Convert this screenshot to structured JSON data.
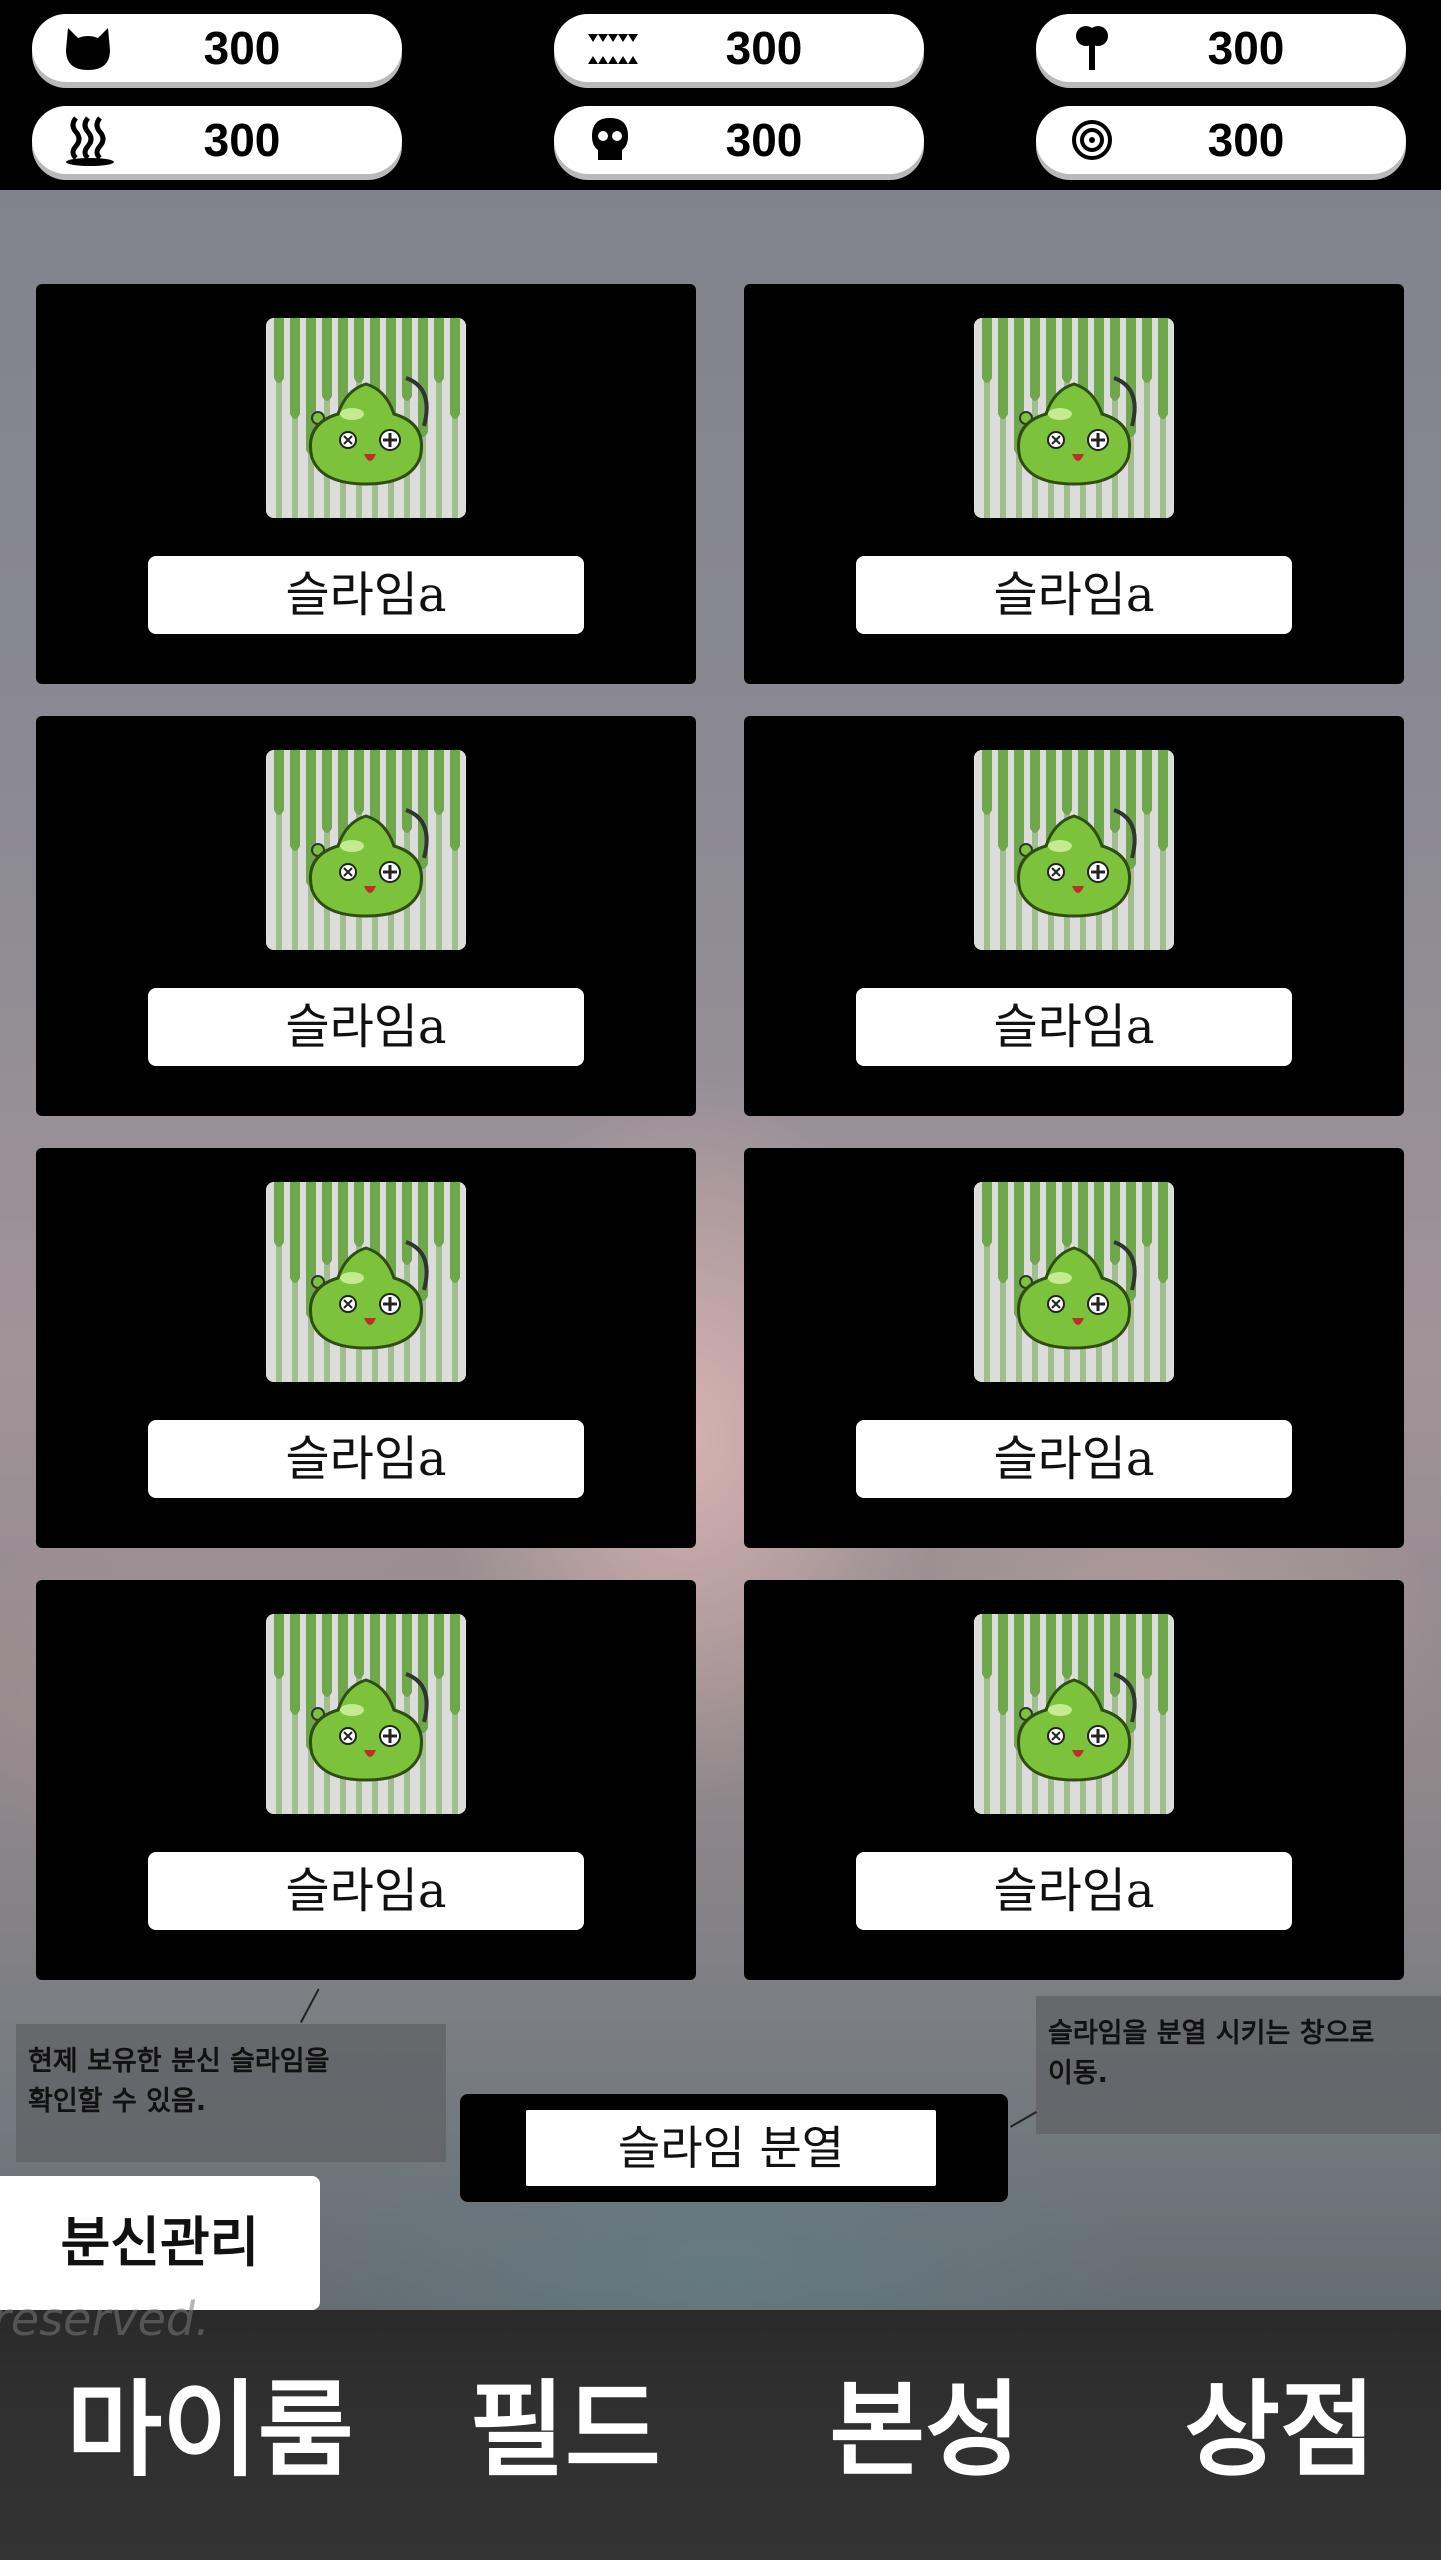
{
  "resources": [
    {
      "icon": "cat-face-icon",
      "value": "300"
    },
    {
      "icon": "spike-teeth-icon",
      "value": "300"
    },
    {
      "icon": "tree-icon",
      "value": "300"
    },
    {
      "icon": "steam-icon",
      "value": "300"
    },
    {
      "icon": "skull-icon",
      "value": "300"
    },
    {
      "icon": "target-icon",
      "value": "300"
    }
  ],
  "clones": [
    {
      "name": "슬라임a"
    },
    {
      "name": "슬라임a"
    },
    {
      "name": "슬라임a"
    },
    {
      "name": "슬라임a"
    },
    {
      "name": "슬라임a"
    },
    {
      "name": "슬라임a"
    },
    {
      "name": "슬라임a"
    },
    {
      "name": "슬라임a"
    }
  ],
  "notes": {
    "left": "현제 보유한 분신 슬라임을\n확인할 수 있음.",
    "right": "슬라임을 분열 시키는 창으로\n이동."
  },
  "split_button": "슬라임 분열",
  "clone_manage_tab": "분신관리",
  "watermark": "reserved.",
  "nav": {
    "myroom": "마이룸",
    "field": "필드",
    "base": "본성",
    "shop": "상점"
  },
  "colors": {
    "slime_green": "#7cc23a",
    "drip_green": "#6fa84a",
    "panel": "#000000"
  }
}
